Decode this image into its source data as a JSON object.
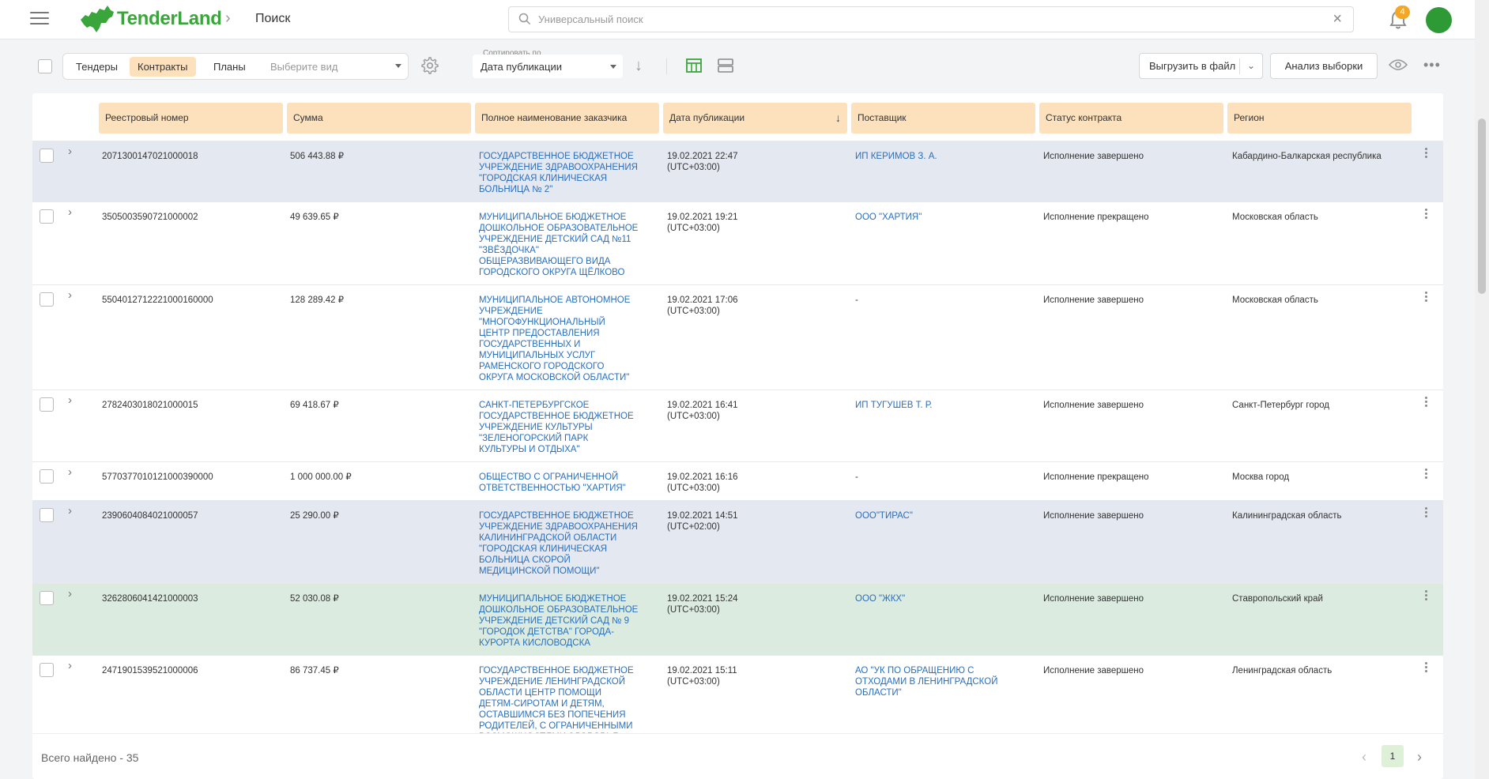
{
  "header": {
    "brand": "TenderLand",
    "breadcrumb": "Поиск",
    "search_placeholder": "Универсальный поиск",
    "notifications_count": "4"
  },
  "toolbar": {
    "tabs": [
      "Тендеры",
      "Контракты",
      "Планы"
    ],
    "active_tab": "Контракты",
    "view_placeholder": "Выберите вид",
    "sort_label": "Сортировать по",
    "sort_value": "Дата публикации",
    "export_label": "Выгрузить в файл",
    "analysis_label": "Анализ выборки"
  },
  "table": {
    "columns": [
      "Реестровый номер",
      "Сумма",
      "Полное наименование заказчика",
      "Дата публикации",
      "Поставщик",
      "Статус контракта",
      "Регион"
    ],
    "rows": [
      {
        "number": "2071300147021000018",
        "sum": "506 443.88 ₽",
        "customer": [
          "ГОСУДАРСТВЕННОЕ БЮДЖЕТНОЕ",
          "УЧРЕЖДЕНИЕ ЗДРАВООХРАНЕНИЯ",
          "\"ГОРОДСКАЯ КЛИНИЧЕСКАЯ",
          "БОЛЬНИЦА № 2\""
        ],
        "date": "19.02.2021 22:47",
        "tz": "(UTC+03:00)",
        "supplier": [
          "ИП КЕРИМОВ З. А."
        ],
        "status": "Исполнение завершено",
        "region": "Кабардино-Балкарская республика",
        "bg": "#e4e8f0"
      },
      {
        "number": "3505003590721000002",
        "sum": "49 639.65 ₽",
        "customer": [
          "МУНИЦИПАЛЬНОЕ БЮДЖЕТНОЕ",
          "ДОШКОЛЬНОЕ ОБРАЗОВАТЕЛЬНОЕ",
          "УЧРЕЖДЕНИЕ ДЕТСКИЙ САД №11",
          "\"ЗВЁЗДОЧКА\"",
          "ОБЩЕРАЗВИВАЮЩЕГО ВИДА",
          "ГОРОДСКОГО ОКРУГА ЩЁЛКОВО"
        ],
        "date": "19.02.2021 19:21",
        "tz": "(UTC+03:00)",
        "supplier": [
          "ООО \"ХАРТИЯ\""
        ],
        "status": "Исполнение прекращено",
        "region": "Московская область",
        "bg": "#ffffff"
      },
      {
        "number": "5504012712221000160000",
        "sum": "128 289.42 ₽",
        "customer": [
          "МУНИЦИПАЛЬНОЕ АВТОНОМНОЕ",
          "УЧРЕЖДЕНИЕ",
          "\"МНОГОФУНКЦИОНАЛЬНЫЙ",
          "ЦЕНТР ПРЕДОСТАВЛЕНИЯ",
          "ГОСУДАРСТВЕННЫХ И",
          "МУНИЦИПАЛЬНЫХ УСЛУГ",
          "РАМЕНСКОГО ГОРОДСКОГО",
          "ОКРУГА МОСКОВСКОЙ ОБЛАСТИ\""
        ],
        "date": "19.02.2021 17:06",
        "tz": "(UTC+03:00)",
        "supplier_plain": "-",
        "status": "Исполнение завершено",
        "region": "Московская область",
        "bg": "#ffffff"
      },
      {
        "number": "2782403018021000015",
        "sum": "69 418.67 ₽",
        "customer": [
          "САНКТ-ПЕТЕРБУРГСКОЕ",
          "ГОСУДАРСТВЕННОЕ БЮДЖЕТНОЕ",
          "УЧРЕЖДЕНИЕ КУЛЬТУРЫ",
          "\"ЗЕЛЕНОГОРСКИЙ ПАРК",
          "КУЛЬТУРЫ И ОТДЫХА\""
        ],
        "date": "19.02.2021 16:41",
        "tz": "(UTC+03:00)",
        "supplier": [
          "ИП ТУГУШЕВ Т. Р."
        ],
        "status": "Исполнение завершено",
        "region": "Санкт-Петербург город",
        "bg": "#ffffff"
      },
      {
        "number": "5770377010121000390000",
        "sum": "1 000 000.00 ₽",
        "customer": [
          "ОБЩЕСТВО С ОГРАНИЧЕННОЙ",
          "ОТВЕТСТВЕННОСТЬЮ \"ХАРТИЯ\""
        ],
        "date": "19.02.2021 16:16",
        "tz": "(UTC+03:00)",
        "supplier_plain": "-",
        "status": "Исполнение прекращено",
        "region": "Москва город",
        "bg": "#ffffff"
      },
      {
        "number": "2390604084021000057",
        "sum": "25 290.00 ₽",
        "customer": [
          "ГОСУДАРСТВЕННОЕ БЮДЖЕТНОЕ",
          "УЧРЕЖДЕНИЕ ЗДРАВООХРАНЕНИЯ",
          "КАЛИНИНГРАДСКОЙ ОБЛАСТИ",
          "\"ГОРОДСКАЯ КЛИНИЧЕСКАЯ",
          "БОЛЬНИЦА СКОРОЙ",
          "МЕДИЦИНСКОЙ ПОМОЩИ\""
        ],
        "date": "19.02.2021 14:51",
        "tz": "(UTC+02:00)",
        "supplier": [
          "ООО\"ТИРАС\""
        ],
        "status": "Исполнение завершено",
        "region": "Калининградская область",
        "bg": "#e4e8f0"
      },
      {
        "number": "3262806041421000003",
        "sum": "52 030.08 ₽",
        "customer": [
          "МУНИЦИПАЛЬНОЕ БЮДЖЕТНОЕ",
          "ДОШКОЛЬНОЕ ОБРАЗОВАТЕЛЬНОЕ",
          "УЧРЕЖДЕНИЕ ДЕТСКИЙ САД № 9",
          "\"ГОРОДОК ДЕТСТВА\" ГОРОДА-",
          "КУРОРТА КИСЛОВОДСКА"
        ],
        "date": "19.02.2021 15:24",
        "tz": "(UTC+03:00)",
        "supplier": [
          "ООО \"ЖКХ\""
        ],
        "status": "Исполнение завершено",
        "region": "Ставропольский край",
        "bg": "#dcebdf"
      },
      {
        "number": "2471901539521000006",
        "sum": "86 737.45 ₽",
        "customer": [
          "ГОСУДАРСТВЕННОЕ БЮДЖЕТНОЕ",
          "УЧРЕЖДЕНИЕ ЛЕНИНГРАДСКОЙ",
          "ОБЛАСТИ ЦЕНТР ПОМОЩИ",
          "ДЕТЯМ-СИРОТАМ И ДЕТЯМ,",
          "ОСТАВШИМСЯ БЕЗ ПОПЕЧЕНИЯ",
          "РОДИТЕЛЕЙ, С ОГРАНИЧЕННЫМИ",
          "ВОЗМОЖНОСТЯМИ ЗДОРОВЬЯ"
        ],
        "date": "19.02.2021 15:11",
        "tz": "(UTC+03:00)",
        "supplier": [
          "АО \"УК ПО ОБРАЩЕНИЮ С",
          "ОТХОДАМИ В ЛЕНИНГРАДСКОЙ",
          "ОБЛАСТИ\""
        ],
        "status": "Исполнение завершено",
        "region": "Ленинградская область",
        "bg": "#ffffff"
      }
    ]
  },
  "footer": {
    "total": "Всего найдено - 35",
    "page": "1"
  },
  "colors": {
    "brand_green": "#3aa53a",
    "header_cell": "#fde1bd",
    "link": "#2a6fbd",
    "badge": "#f5a623"
  }
}
